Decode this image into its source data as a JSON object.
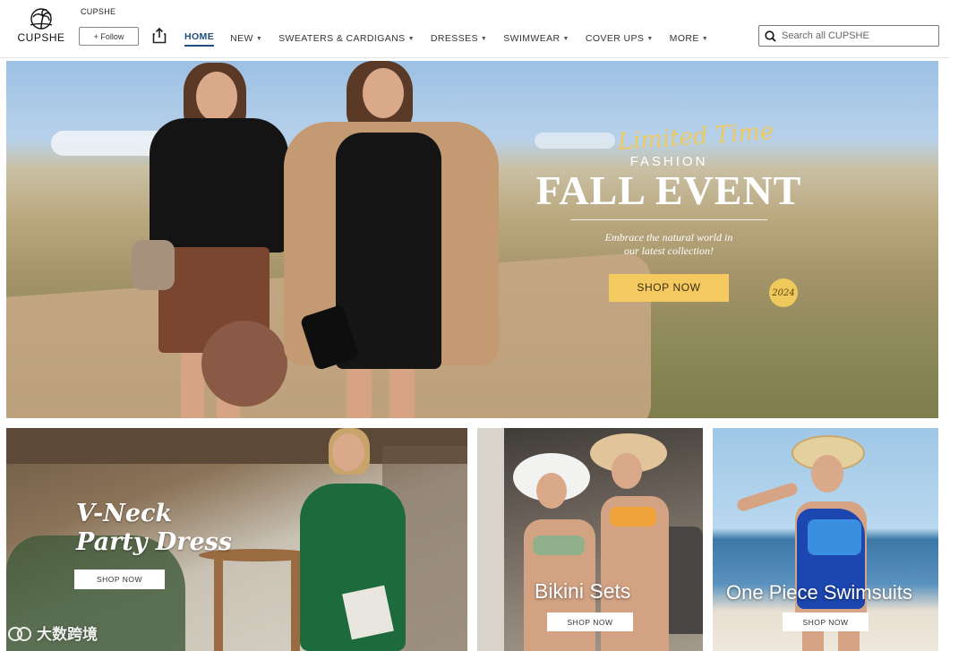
{
  "header": {
    "logo_text": "CUPSHE",
    "store_name": "CUPSHE",
    "follow_label": "+ Follow",
    "nav": [
      {
        "label": "HOME",
        "dropdown": false,
        "active": true
      },
      {
        "label": "NEW",
        "dropdown": true
      },
      {
        "label": "SWEATERS & CARDIGANS",
        "dropdown": true
      },
      {
        "label": "DRESSES",
        "dropdown": true
      },
      {
        "label": "SWIMWEAR",
        "dropdown": true
      },
      {
        "label": "COVER UPS",
        "dropdown": true
      },
      {
        "label": "MORE",
        "dropdown": true
      }
    ],
    "search_placeholder": "Search all CUPSHE"
  },
  "hero": {
    "script_title": "Limited Time",
    "kicker": "FASHION",
    "title": "FALL EVENT",
    "year": "2024",
    "tagline_line1": "Embrace the natural world in",
    "tagline_line2": "our latest collection!",
    "cta": "SHOP NOW",
    "accent_color": "#f4c960"
  },
  "tiles": [
    {
      "title_line1": "V-Neck",
      "title_line2": "Party Dress",
      "cta": "SHOP NOW"
    },
    {
      "title": "Bikini Sets",
      "cta": "SHOP NOW"
    },
    {
      "title": "One Piece Swimsuits",
      "cta": "SHOP NOW"
    }
  ],
  "watermark": "大数跨境"
}
